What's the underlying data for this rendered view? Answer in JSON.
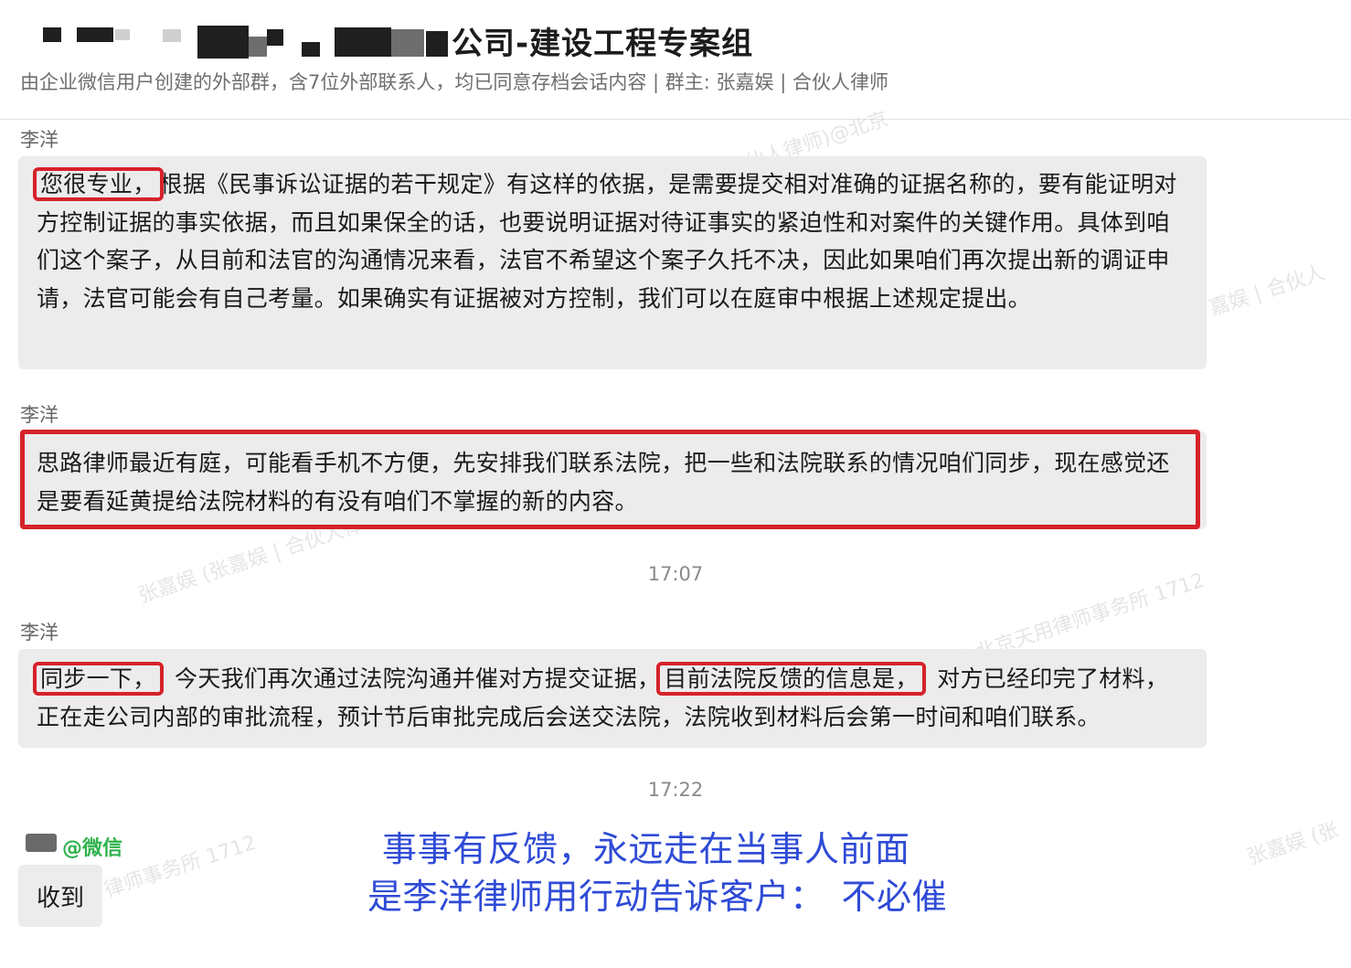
{
  "header": {
    "group_title": "公司-建设工程专案组",
    "subtitle": "由企业微信用户创建的外部群，含7位外部联系人，均已同意存档会话内容 | 群主: 张嘉娱 | 合伙人律师"
  },
  "messages": [
    {
      "sender": "李洋",
      "highlight": "您很专业，",
      "text": "根据《民事诉讼证据的若干规定》有这样的依据，是需要提交相对准确的证据名称的，要有能证明对方控制证据的事实依据，而且如果保全的话，也要说明证据对待证事实的紧迫性和对案件的关键作用。具体到咱们这个案子，从目前和法官的沟通情况来看，法官不希望这个案子久托不决，因此如果咱们再次提出新的调证申请，法官可能会有自己考量。如果确实有证据被对方控制，我们可以在庭审中根据上述规定提出。"
    },
    {
      "sender": "李洋",
      "text": "思路律师最近有庭，可能看手机不方便，先安排我们联系法院，把一些和法院联系的情况咱们同步，现在感觉还是要看延黄提给法院材料的有没有咱们不掌握的新的内容。"
    },
    {
      "sender": "李洋",
      "highlight1": "同步一下，",
      "text1": "今天我们再次通过法院沟通并催对方提交证据，",
      "highlight2": "目前法院反馈的信息是，",
      "text2": "对方已经印完了材料，正在走公司内部的审批流程，预计节后审批完成后会送交法院，法院收到材料后会第一时间和咱们联系。"
    }
  ],
  "timestamps": [
    "17:07",
    "17:22"
  ],
  "reply": {
    "sender_tag": "@微信",
    "text": "收到"
  },
  "slogan": {
    "line1": "事事有反馈，永远走在当事人前面",
    "line2": "是李洋律师用行动告诉客户：",
    "line2_emphasis": "不必催"
  },
  "watermarks": [
    "合伙人律师)@北京",
    "张嘉娱 (张嘉娱 | 合伙人律",
    "嘉娱 | 合伙人",
    "@北京天用律师事务所 1712",
    "律师事务所 1712",
    "张嘉娱 (张"
  ],
  "colors": {
    "highlight_red": "#d6222a",
    "bubble_gray": "#ececec",
    "wechat_green": "#2fb24c",
    "slogan_blue": "#2f4bd6"
  }
}
